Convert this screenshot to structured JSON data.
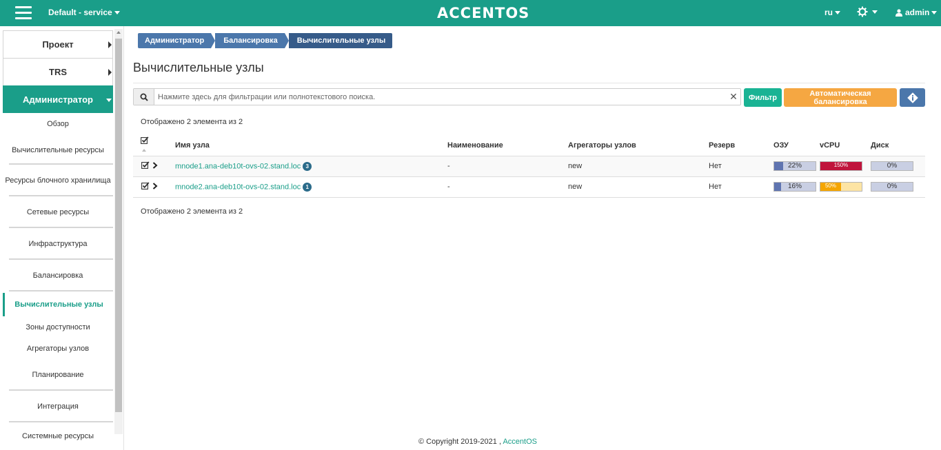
{
  "header": {
    "project_selector": "Default - service",
    "logo": "ACCENTOS",
    "language": "ru",
    "user": "admin"
  },
  "sidebar": {
    "top_items": [
      {
        "label": "Проект"
      },
      {
        "label": "TRS"
      },
      {
        "label": "Администратор"
      }
    ],
    "sub_items": [
      {
        "label": "Обзор"
      },
      {
        "label": "Вычислительные ресурсы"
      },
      {
        "label": "Ресурсы блочного хранилища"
      },
      {
        "label": "Сетевые ресурсы"
      },
      {
        "label": "Инфраструктура"
      },
      {
        "label": "Балансировка"
      },
      {
        "label": "Вычислительные узлы"
      },
      {
        "label": "Зоны доступности"
      },
      {
        "label": "Агрегаторы узлов"
      },
      {
        "label": "Планирование"
      },
      {
        "label": "Интеграция"
      },
      {
        "label": "Системные ресурсы"
      }
    ]
  },
  "breadcrumb": [
    "Администратор",
    "Балансировка",
    "Вычислительные узлы"
  ],
  "page_title": "Вычислительные узлы",
  "search": {
    "placeholder": "Нажмите здесь для фильтрации или полнотекстового поиска.",
    "value": ""
  },
  "buttons": {
    "filter": "Фильтр",
    "auto_balance": "Автоматическая балансировка"
  },
  "count_text": "Отображено 2 элемента из 2",
  "table": {
    "columns": [
      "Имя узла",
      "Наименование",
      "Агрегаторы узлов",
      "Резерв",
      "ОЗУ",
      "vCPU",
      "Диск"
    ],
    "rows": [
      {
        "host": "mnode1.ana-deb10t-ovs-02.stand.loc",
        "badge": "3",
        "name": "-",
        "aggregates": "new",
        "reserve": "Нет",
        "ram_label": "22%",
        "ram_value": 22,
        "vcpu_label": "150%",
        "vcpu_value": 150,
        "disk_label": "0%",
        "disk_value": 0
      },
      {
        "host": "mnode2.ana-deb10t-ovs-02.stand.loc",
        "badge": "1",
        "name": "-",
        "aggregates": "new",
        "reserve": "Нет",
        "ram_label": "16%",
        "ram_value": 16,
        "vcpu_label": "50%",
        "vcpu_value": 50,
        "disk_label": "0%",
        "disk_value": 0
      }
    ]
  },
  "colors": {
    "accent": "#1a9e89",
    "breadcrumb": "#4b77ab",
    "ram_fill": "#5f74b0",
    "ram_bg": "#c9cfe3",
    "vcpu_over": "#c0143c",
    "vcpu_warn": "#f5a500",
    "vcpu_warn_bg": "#fde4a4",
    "disk_bg": "#c9cfe3"
  },
  "footer": {
    "copyright": "© Copyright 2019-2021 ,",
    "brand": "AccentOS"
  }
}
